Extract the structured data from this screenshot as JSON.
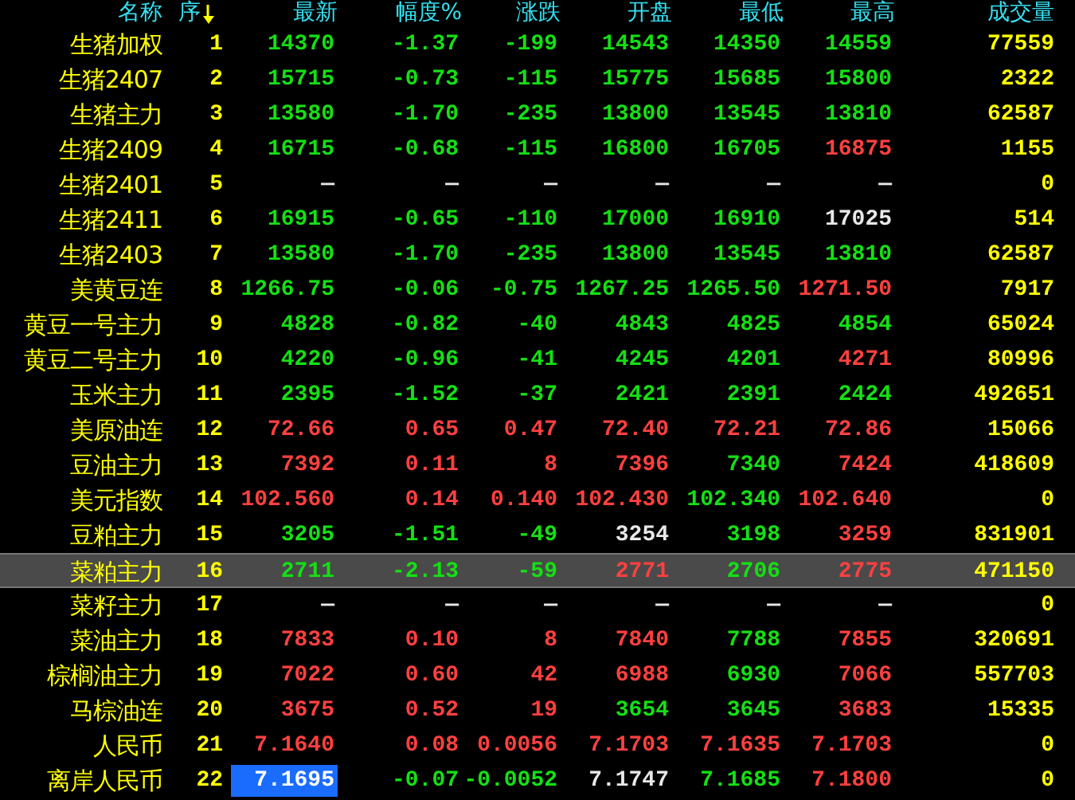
{
  "columns": [
    {
      "label": "名称",
      "sorted": false
    },
    {
      "label": "序",
      "sorted": true
    },
    {
      "label": "最新",
      "sorted": false
    },
    {
      "label": "幅度%",
      "sorted": false
    },
    {
      "label": "涨跌",
      "sorted": false
    },
    {
      "label": "开盘",
      "sorted": false
    },
    {
      "label": "最低",
      "sorted": false
    },
    {
      "label": "最高",
      "sorted": false
    },
    {
      "label": "成交量",
      "sorted": false
    }
  ],
  "rows": [
    {
      "name": "生猪加权",
      "seq": "1",
      "selected": false,
      "cursor": false,
      "cells": [
        {
          "text": "14370",
          "color": "#14e014"
        },
        {
          "text": "-1.37",
          "color": "#14e014"
        },
        {
          "text": "-199",
          "color": "#14e014"
        },
        {
          "text": "14543",
          "color": "#14e014"
        },
        {
          "text": "14350",
          "color": "#14e014"
        },
        {
          "text": "14559",
          "color": "#14e014"
        }
      ],
      "volume": "77559"
    },
    {
      "name": "生猪2407",
      "seq": "2",
      "selected": false,
      "cursor": false,
      "cells": [
        {
          "text": "15715",
          "color": "#14e014"
        },
        {
          "text": "-0.73",
          "color": "#14e014"
        },
        {
          "text": "-115",
          "color": "#14e014"
        },
        {
          "text": "15775",
          "color": "#14e014"
        },
        {
          "text": "15685",
          "color": "#14e014"
        },
        {
          "text": "15800",
          "color": "#14e014"
        }
      ],
      "volume": "2322"
    },
    {
      "name": "生猪主力",
      "seq": "3",
      "selected": false,
      "cursor": false,
      "cells": [
        {
          "text": "13580",
          "color": "#14e014"
        },
        {
          "text": "-1.70",
          "color": "#14e014"
        },
        {
          "text": "-235",
          "color": "#14e014"
        },
        {
          "text": "13800",
          "color": "#14e014"
        },
        {
          "text": "13545",
          "color": "#14e014"
        },
        {
          "text": "13810",
          "color": "#14e014"
        }
      ],
      "volume": "62587"
    },
    {
      "name": "生猪2409",
      "seq": "4",
      "selected": false,
      "cursor": false,
      "cells": [
        {
          "text": "16715",
          "color": "#14e014"
        },
        {
          "text": "-0.68",
          "color": "#14e014"
        },
        {
          "text": "-115",
          "color": "#14e014"
        },
        {
          "text": "16800",
          "color": "#14e014"
        },
        {
          "text": "16705",
          "color": "#14e014"
        },
        {
          "text": "16875",
          "color": "#ff4040"
        }
      ],
      "volume": "1155"
    },
    {
      "name": "生猪2401",
      "seq": "5",
      "selected": false,
      "cursor": false,
      "cells": [
        {
          "text": "—",
          "color": "#e8e8e8"
        },
        {
          "text": "—",
          "color": "#e8e8e8"
        },
        {
          "text": "—",
          "color": "#e8e8e8"
        },
        {
          "text": "—",
          "color": "#e8e8e8"
        },
        {
          "text": "—",
          "color": "#e8e8e8"
        },
        {
          "text": "—",
          "color": "#e8e8e8"
        }
      ],
      "volume": "0"
    },
    {
      "name": "生猪2411",
      "seq": "6",
      "selected": false,
      "cursor": false,
      "cells": [
        {
          "text": "16915",
          "color": "#14e014"
        },
        {
          "text": "-0.65",
          "color": "#14e014"
        },
        {
          "text": "-110",
          "color": "#14e014"
        },
        {
          "text": "17000",
          "color": "#14e014"
        },
        {
          "text": "16910",
          "color": "#14e014"
        },
        {
          "text": "17025",
          "color": "#e8e8e8"
        }
      ],
      "volume": "514"
    },
    {
      "name": "生猪2403",
      "seq": "7",
      "selected": false,
      "cursor": false,
      "cells": [
        {
          "text": "13580",
          "color": "#14e014"
        },
        {
          "text": "-1.70",
          "color": "#14e014"
        },
        {
          "text": "-235",
          "color": "#14e014"
        },
        {
          "text": "13800",
          "color": "#14e014"
        },
        {
          "text": "13545",
          "color": "#14e014"
        },
        {
          "text": "13810",
          "color": "#14e014"
        }
      ],
      "volume": "62587"
    },
    {
      "name": "美黄豆连",
      "seq": "8",
      "selected": false,
      "cursor": false,
      "cells": [
        {
          "text": "1266.75",
          "color": "#14e014"
        },
        {
          "text": "-0.06",
          "color": "#14e014"
        },
        {
          "text": "-0.75",
          "color": "#14e014"
        },
        {
          "text": "1267.25",
          "color": "#14e014"
        },
        {
          "text": "1265.50",
          "color": "#14e014"
        },
        {
          "text": "1271.50",
          "color": "#ff4040"
        }
      ],
      "volume": "7917"
    },
    {
      "name": "黄豆一号主力",
      "seq": "9",
      "selected": false,
      "cursor": false,
      "cells": [
        {
          "text": "4828",
          "color": "#14e014"
        },
        {
          "text": "-0.82",
          "color": "#14e014"
        },
        {
          "text": "-40",
          "color": "#14e014"
        },
        {
          "text": "4843",
          "color": "#14e014"
        },
        {
          "text": "4825",
          "color": "#14e014"
        },
        {
          "text": "4854",
          "color": "#14e014"
        }
      ],
      "volume": "65024"
    },
    {
      "name": "黄豆二号主力",
      "seq": "10",
      "selected": false,
      "cursor": false,
      "cells": [
        {
          "text": "4220",
          "color": "#14e014"
        },
        {
          "text": "-0.96",
          "color": "#14e014"
        },
        {
          "text": "-41",
          "color": "#14e014"
        },
        {
          "text": "4245",
          "color": "#14e014"
        },
        {
          "text": "4201",
          "color": "#14e014"
        },
        {
          "text": "4271",
          "color": "#ff4040"
        }
      ],
      "volume": "80996"
    },
    {
      "name": "玉米主力",
      "seq": "11",
      "selected": false,
      "cursor": false,
      "cells": [
        {
          "text": "2395",
          "color": "#14e014"
        },
        {
          "text": "-1.52",
          "color": "#14e014"
        },
        {
          "text": "-37",
          "color": "#14e014"
        },
        {
          "text": "2421",
          "color": "#14e014"
        },
        {
          "text": "2391",
          "color": "#14e014"
        },
        {
          "text": "2424",
          "color": "#14e014"
        }
      ],
      "volume": "492651"
    },
    {
      "name": "美原油连",
      "seq": "12",
      "selected": false,
      "cursor": false,
      "cells": [
        {
          "text": "72.66",
          "color": "#ff4040"
        },
        {
          "text": "0.65",
          "color": "#ff4040"
        },
        {
          "text": "0.47",
          "color": "#ff4040"
        },
        {
          "text": "72.40",
          "color": "#ff4040"
        },
        {
          "text": "72.21",
          "color": "#ff4040"
        },
        {
          "text": "72.86",
          "color": "#ff4040"
        }
      ],
      "volume": "15066"
    },
    {
      "name": "豆油主力",
      "seq": "13",
      "selected": false,
      "cursor": false,
      "cells": [
        {
          "text": "7392",
          "color": "#ff4040"
        },
        {
          "text": "0.11",
          "color": "#ff4040"
        },
        {
          "text": "8",
          "color": "#ff4040"
        },
        {
          "text": "7396",
          "color": "#ff4040"
        },
        {
          "text": "7340",
          "color": "#14e014"
        },
        {
          "text": "7424",
          "color": "#ff4040"
        }
      ],
      "volume": "418609"
    },
    {
      "name": "美元指数",
      "seq": "14",
      "selected": false,
      "cursor": false,
      "cells": [
        {
          "text": "102.560",
          "color": "#ff4040"
        },
        {
          "text": "0.14",
          "color": "#ff4040"
        },
        {
          "text": "0.140",
          "color": "#ff4040"
        },
        {
          "text": "102.430",
          "color": "#ff4040"
        },
        {
          "text": "102.340",
          "color": "#14e014"
        },
        {
          "text": "102.640",
          "color": "#ff4040"
        }
      ],
      "volume": "0"
    },
    {
      "name": "豆粕主力",
      "seq": "15",
      "selected": false,
      "cursor": false,
      "cells": [
        {
          "text": "3205",
          "color": "#14e014"
        },
        {
          "text": "-1.51",
          "color": "#14e014"
        },
        {
          "text": "-49",
          "color": "#14e014"
        },
        {
          "text": "3254",
          "color": "#e8e8e8"
        },
        {
          "text": "3198",
          "color": "#14e014"
        },
        {
          "text": "3259",
          "color": "#ff4040"
        }
      ],
      "volume": "831901"
    },
    {
      "name": "菜粕主力",
      "seq": "16",
      "selected": true,
      "cursor": false,
      "cells": [
        {
          "text": "2711",
          "color": "#14e014"
        },
        {
          "text": "-2.13",
          "color": "#14e014"
        },
        {
          "text": "-59",
          "color": "#14e014"
        },
        {
          "text": "2771",
          "color": "#ff4040"
        },
        {
          "text": "2706",
          "color": "#14e014"
        },
        {
          "text": "2775",
          "color": "#ff4040"
        }
      ],
      "volume": "471150"
    },
    {
      "name": "菜籽主力",
      "seq": "17",
      "selected": false,
      "cursor": false,
      "cells": [
        {
          "text": "—",
          "color": "#e8e8e8"
        },
        {
          "text": "—",
          "color": "#e8e8e8"
        },
        {
          "text": "—",
          "color": "#e8e8e8"
        },
        {
          "text": "—",
          "color": "#e8e8e8"
        },
        {
          "text": "—",
          "color": "#e8e8e8"
        },
        {
          "text": "—",
          "color": "#e8e8e8"
        }
      ],
      "volume": "0"
    },
    {
      "name": "菜油主力",
      "seq": "18",
      "selected": false,
      "cursor": false,
      "cells": [
        {
          "text": "7833",
          "color": "#ff4040"
        },
        {
          "text": "0.10",
          "color": "#ff4040"
        },
        {
          "text": "8",
          "color": "#ff4040"
        },
        {
          "text": "7840",
          "color": "#ff4040"
        },
        {
          "text": "7788",
          "color": "#14e014"
        },
        {
          "text": "7855",
          "color": "#ff4040"
        }
      ],
      "volume": "320691"
    },
    {
      "name": "棕榈油主力",
      "seq": "19",
      "selected": false,
      "cursor": false,
      "cells": [
        {
          "text": "7022",
          "color": "#ff4040"
        },
        {
          "text": "0.60",
          "color": "#ff4040"
        },
        {
          "text": "42",
          "color": "#ff4040"
        },
        {
          "text": "6988",
          "color": "#ff4040"
        },
        {
          "text": "6930",
          "color": "#14e014"
        },
        {
          "text": "7066",
          "color": "#ff4040"
        }
      ],
      "volume": "557703"
    },
    {
      "name": "马棕油连",
      "seq": "20",
      "selected": false,
      "cursor": false,
      "cells": [
        {
          "text": "3675",
          "color": "#ff4040"
        },
        {
          "text": "0.52",
          "color": "#ff4040"
        },
        {
          "text": "19",
          "color": "#ff4040"
        },
        {
          "text": "3654",
          "color": "#14e014"
        },
        {
          "text": "3645",
          "color": "#14e014"
        },
        {
          "text": "3683",
          "color": "#ff4040"
        }
      ],
      "volume": "15335"
    },
    {
      "name": "人民币",
      "seq": "21",
      "selected": false,
      "cursor": false,
      "cells": [
        {
          "text": "7.1640",
          "color": "#ff4040"
        },
        {
          "text": "0.08",
          "color": "#ff4040"
        },
        {
          "text": "0.0056",
          "color": "#ff4040"
        },
        {
          "text": "7.1703",
          "color": "#ff4040"
        },
        {
          "text": "7.1635",
          "color": "#ff4040"
        },
        {
          "text": "7.1703",
          "color": "#ff4040"
        }
      ],
      "volume": "0"
    },
    {
      "name": "离岸人民币",
      "seq": "22",
      "selected": false,
      "cursor": true,
      "cells": [
        {
          "text": "7.1695"
        },
        {
          "text": "-0.07",
          "color": "#14e014"
        },
        {
          "text": "-0.0052",
          "color": "#14e014"
        },
        {
          "text": "7.1747",
          "color": "#e8e8e8"
        },
        {
          "text": "7.1685",
          "color": "#14e014"
        },
        {
          "text": "7.1800",
          "color": "#ff4040"
        }
      ],
      "volume": "0"
    }
  ]
}
